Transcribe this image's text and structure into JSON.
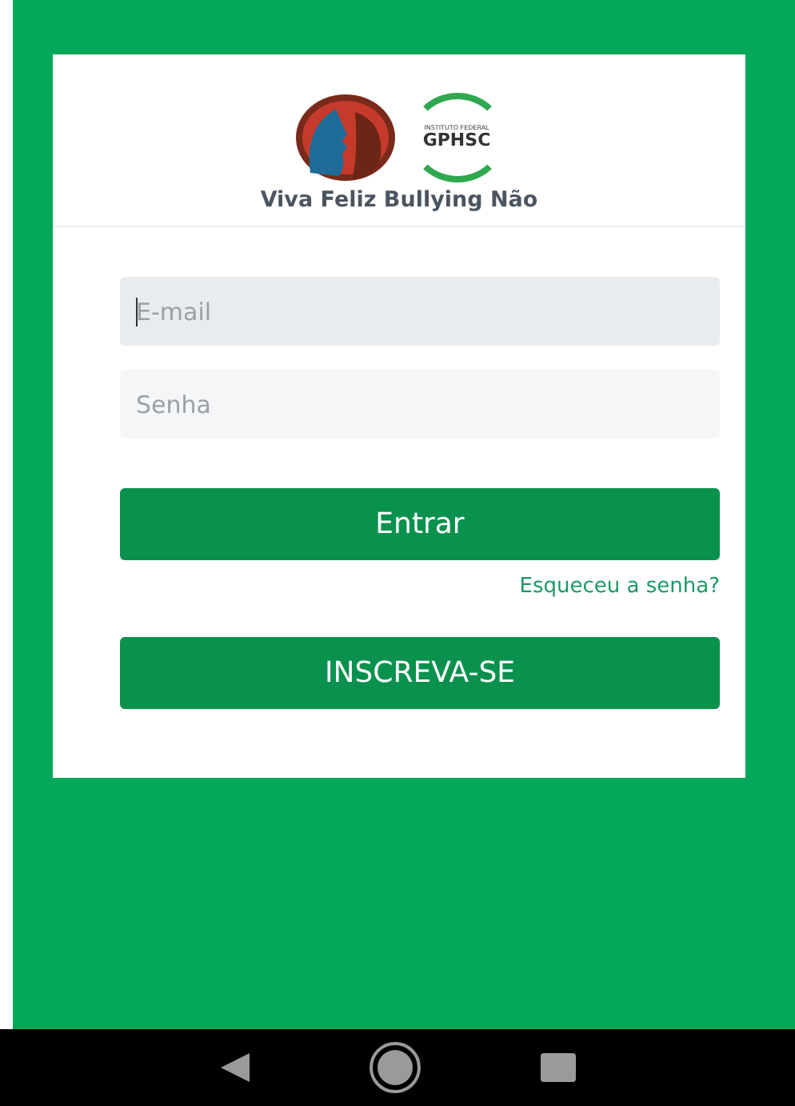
{
  "header": {
    "logo_badge": {
      "top_text": "INSTITUTO FEDERAL",
      "name": "GPHSC"
    },
    "app_name": "Viva Feliz Bullying Não"
  },
  "fields": [
    {
      "placeholder": "E-mail",
      "focused": true
    },
    {
      "placeholder": "Senha",
      "focused": false
    }
  ],
  "login_button": "Entrar",
  "forgot_link": "Esqueceu a senha?",
  "signup_button": "INSCREVA-SE"
}
